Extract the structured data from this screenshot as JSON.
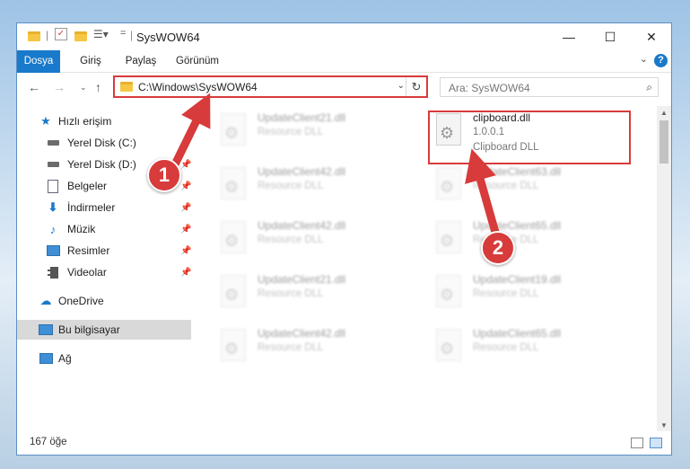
{
  "window": {
    "title": "SysWOW64",
    "controls": [
      "—",
      "☐",
      "✕"
    ]
  },
  "ribbon": {
    "tabs": [
      "Dosya",
      "Giriş",
      "Paylaş",
      "Görünüm"
    ]
  },
  "nav": {
    "address": "C:\\Windows\\SysWOW64",
    "search_placeholder": "Ara: SysWOW64"
  },
  "sidebar": {
    "items": [
      {
        "label": "Hızlı erişim",
        "icon": "star-icon",
        "pinned": false
      },
      {
        "label": "Yerel Disk (C:)",
        "icon": "drive-icon",
        "pinned": true
      },
      {
        "label": "Yerel Disk (D:)",
        "icon": "drive-icon",
        "pinned": true
      },
      {
        "label": "Belgeler",
        "icon": "documents-icon",
        "pinned": true
      },
      {
        "label": "İndirmeler",
        "icon": "download-icon",
        "pinned": true
      },
      {
        "label": "Müzik",
        "icon": "music-icon",
        "pinned": true
      },
      {
        "label": "Resimler",
        "icon": "pictures-icon",
        "pinned": true
      },
      {
        "label": "Videolar",
        "icon": "videos-icon",
        "pinned": true
      },
      {
        "label": "OneDrive",
        "icon": "cloud-icon",
        "pinned": false
      },
      {
        "label": "Bu bilgisayar",
        "icon": "computer-icon",
        "pinned": false
      },
      {
        "label": "Ağ",
        "icon": "network-icon",
        "pinned": false
      }
    ]
  },
  "files": {
    "main": {
      "name": "clipboard.dll",
      "version": "1.0.0.1",
      "description": "Clipboard DLL"
    },
    "blurred": [
      {
        "name": "UpdateClient21.dll",
        "type": "Resource DLL"
      },
      {
        "name": "UpdateClient42.dll",
        "type": "Resource DLL"
      },
      {
        "name": "UpdateClient42.dll",
        "type": "Resource DLL"
      },
      {
        "name": "UpdateClient21.dll",
        "type": "Resource DLL"
      },
      {
        "name": "UpdateClient42.dll",
        "type": "Resource DLL"
      },
      {
        "name": "UpdateClient63.dll",
        "type": "Resource DLL"
      },
      {
        "name": "UpdateClient65.dll",
        "type": "Resource DLL"
      },
      {
        "name": "UpdateClient19.dll",
        "type": "Resource DLL"
      },
      {
        "name": "UpdateClient65.dll",
        "type": "Resource DLL"
      }
    ]
  },
  "status": {
    "count": "167 öğe"
  },
  "annotations": {
    "step1": "1",
    "step2": "2",
    "color": "#d83b3b"
  }
}
